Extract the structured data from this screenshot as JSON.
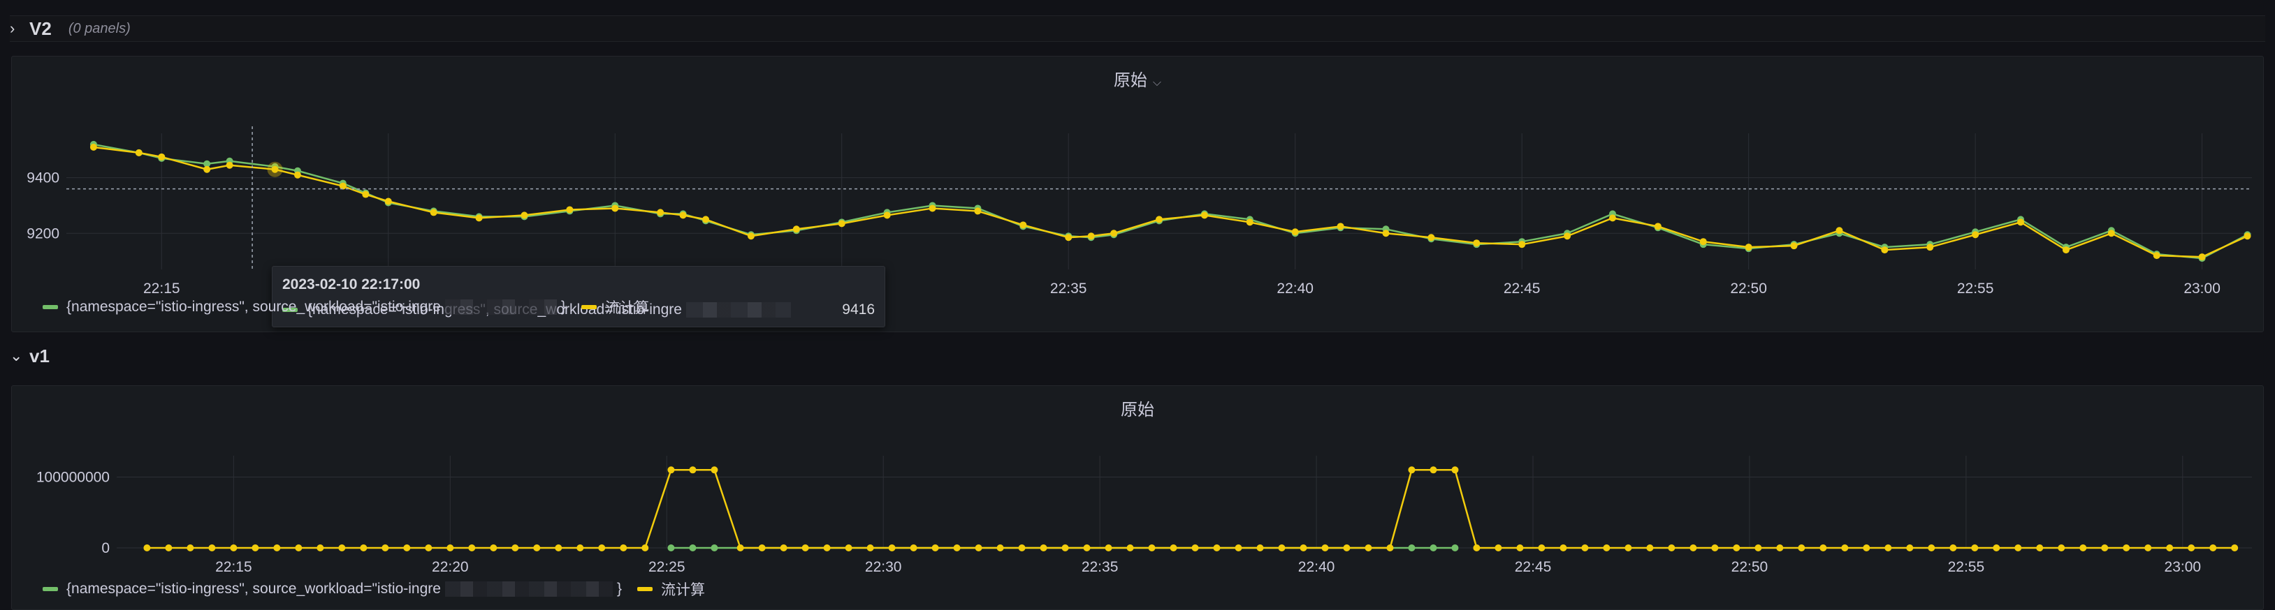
{
  "rows": {
    "v2": {
      "title": "V2",
      "count": "(0 panels)"
    },
    "v1": {
      "title": "v1"
    }
  },
  "colors": {
    "green": "#73bf69",
    "yellow": "#f2cc0c"
  },
  "icons": {
    "row_chevron_collapsed": "chevron-right-icon",
    "row_chevron_expanded": "chevron-down-icon",
    "title_dropdown": "chevron-down-icon"
  },
  "panel_v2": {
    "title": "原始"
  },
  "panel_v1": {
    "title": "原始"
  },
  "legend": {
    "green_prefix": "{namespace=\"istio-ingress\", source_workload=\"istio-ingre",
    "green_suffix": "}",
    "yellow": "流计算"
  },
  "tooltip": {
    "time": "2023-02-10 22:17:00",
    "series": "{namespace=\"istio-ingress\", source_workload=\"istio-ingre",
    "value": "9416"
  },
  "chart_data": [
    {
      "type": "line",
      "title": "原始",
      "x_ticks": [
        "22:15",
        "22:20",
        "22:25",
        "22:30",
        "22:35",
        "22:40",
        "22:45",
        "22:50",
        "22:55",
        "23:00"
      ],
      "y_ticks": [
        "9200",
        "9400"
      ],
      "ylim": [
        9070,
        9560
      ],
      "xlim_minutes": [
        12.9,
        61.1
      ],
      "series": [
        {
          "name": "{namespace=\"istio-ingress\", source_workload=\"istio-ingre...\"}",
          "color": "#73bf69",
          "x": [
            13.5,
            14.5,
            15,
            16,
            16.5,
            17.5,
            18,
            19,
            19.5,
            20,
            21,
            22,
            23,
            24,
            25,
            26,
            26.5,
            27,
            28,
            29,
            30,
            31,
            32,
            33,
            34,
            35,
            35.5,
            36,
            37,
            38,
            39,
            40,
            41,
            42,
            43,
            44,
            45,
            46,
            47,
            48,
            49,
            50,
            51,
            52,
            53,
            54,
            55,
            56,
            57,
            58,
            59,
            60,
            61
          ],
          "y": [
            9520,
            9490,
            9470,
            9450,
            9460,
            9440,
            9425,
            9380,
            9345,
            9310,
            9280,
            9260,
            9260,
            9280,
            9300,
            9270,
            9270,
            9245,
            9195,
            9210,
            9240,
            9275,
            9300,
            9290,
            9225,
            9190,
            9185,
            9195,
            9245,
            9270,
            9250,
            9200,
            9220,
            9215,
            9180,
            9160,
            9170,
            9200,
            9270,
            9220,
            9160,
            9145,
            9160,
            9200,
            9150,
            9160,
            9205,
            9250,
            9150,
            9210,
            9125,
            9110,
            9195
          ]
        },
        {
          "name": "流计算",
          "color": "#f2cc0c",
          "x": [
            13.5,
            14.5,
            15,
            16,
            16.5,
            17.5,
            18,
            19,
            19.5,
            20,
            21,
            22,
            23,
            24,
            25,
            26,
            26.5,
            27,
            28,
            29,
            30,
            31,
            32,
            33,
            34,
            35,
            35.5,
            36,
            37,
            38,
            39,
            40,
            41,
            42,
            43,
            44,
            45,
            46,
            47,
            48,
            49,
            50,
            51,
            52,
            53,
            54,
            55,
            56,
            57,
            58,
            59,
            60,
            61
          ],
          "y": [
            9510,
            9490,
            9475,
            9430,
            9445,
            9430,
            9410,
            9370,
            9340,
            9315,
            9275,
            9255,
            9265,
            9285,
            9290,
            9275,
            9265,
            9250,
            9190,
            9215,
            9235,
            9265,
            9290,
            9280,
            9230,
            9185,
            9190,
            9200,
            9250,
            9265,
            9240,
            9205,
            9225,
            9200,
            9185,
            9165,
            9160,
            9190,
            9255,
            9225,
            9170,
            9150,
            9155,
            9210,
            9140,
            9150,
            9195,
            9240,
            9140,
            9200,
            9120,
            9115,
            9190
          ]
        }
      ]
    },
    {
      "type": "line",
      "title": "原始",
      "x_ticks": [
        "22:15",
        "22:20",
        "22:25",
        "22:30",
        "22:35",
        "22:40",
        "22:45",
        "22:50",
        "22:55",
        "23:00"
      ],
      "y_ticks": [
        "0",
        "100000000"
      ],
      "ylim": [
        0,
        130000000
      ],
      "xlim_minutes": [
        12.3,
        61.6
      ],
      "series": [
        {
          "name": "{namespace=\"istio-ingress\", source_workload=\"istio-ingre...\"}",
          "color": "#73bf69",
          "x": [
            25.1,
            25.6,
            26.1,
            42.2,
            42.7,
            43.2
          ],
          "y": [
            0,
            0,
            0,
            0,
            0,
            0
          ]
        },
        {
          "name": "流计算",
          "color": "#f2cc0c",
          "x": [
            13,
            13.5,
            14,
            14.5,
            15,
            15.5,
            16,
            16.5,
            17,
            17.5,
            18,
            18.5,
            19,
            19.5,
            20,
            20.5,
            21,
            21.5,
            22,
            22.5,
            23,
            23.5,
            24,
            24.5,
            25.1,
            25.6,
            26.1,
            26.7,
            27.2,
            27.7,
            28.2,
            28.7,
            29.2,
            29.7,
            30.2,
            30.7,
            31.2,
            31.7,
            32.2,
            32.7,
            33.2,
            33.7,
            34.2,
            34.7,
            35.2,
            35.7,
            36.2,
            36.7,
            37.2,
            37.7,
            38.2,
            38.7,
            39.2,
            39.7,
            40.2,
            40.7,
            41.2,
            41.7,
            42.2,
            42.7,
            43.2,
            43.7,
            44.2,
            44.7,
            45.2,
            45.7,
            46.2,
            46.7,
            47.2,
            47.7,
            48.2,
            48.7,
            49.2,
            49.7,
            50.2,
            50.7,
            51.2,
            51.7,
            52.2,
            52.7,
            53.2,
            53.7,
            54.2,
            54.7,
            55.2,
            55.7,
            56.2,
            56.7,
            57.2,
            57.7,
            58.2,
            58.7,
            59.2,
            59.7,
            60.2,
            60.7,
            61.2
          ],
          "y": [
            0,
            0,
            0,
            0,
            0,
            0,
            0,
            0,
            0,
            0,
            0,
            0,
            0,
            0,
            0,
            0,
            0,
            0,
            0,
            0,
            0,
            0,
            0,
            0,
            110000000,
            110000000,
            110000000,
            0,
            0,
            0,
            0,
            0,
            0,
            0,
            0,
            0,
            0,
            0,
            0,
            0,
            0,
            0,
            0,
            0,
            0,
            0,
            0,
            0,
            0,
            0,
            0,
            0,
            0,
            0,
            0,
            0,
            0,
            0,
            110000000,
            110000000,
            110000000,
            0,
            0,
            0,
            0,
            0,
            0,
            0,
            0,
            0,
            0,
            0,
            0,
            0,
            0,
            0,
            0,
            0,
            0,
            0,
            0,
            0,
            0,
            0,
            0,
            0,
            0,
            0,
            0,
            0,
            0,
            0,
            0,
            0,
            0,
            0,
            0
          ]
        }
      ]
    }
  ]
}
